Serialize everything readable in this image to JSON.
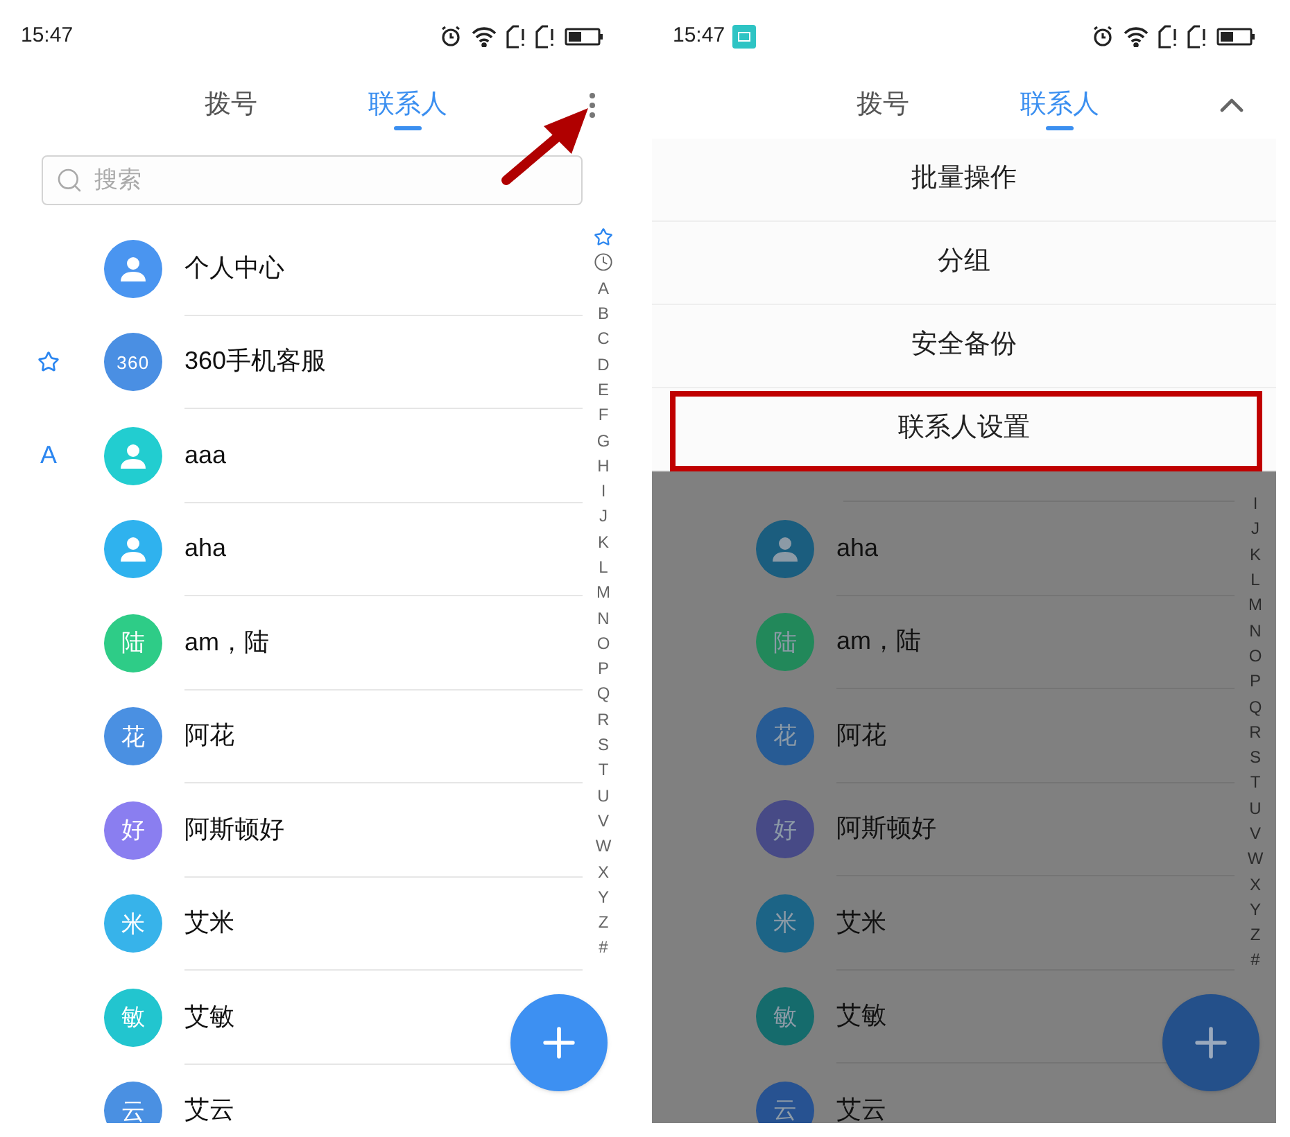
{
  "phones": [
    {
      "status_bar": {
        "time": "15:47",
        "screenshot_badge": false
      },
      "tabs": [
        {
          "label": "拨号",
          "selected": false
        },
        {
          "label": "联系人",
          "selected": true
        }
      ],
      "header_action": {
        "kind": "more"
      },
      "annotation": {
        "kind": "arrow"
      },
      "search": {
        "placeholder": "搜索"
      },
      "dimmed": false,
      "index_rail": [
        {
          "kind": "star"
        },
        {
          "kind": "clock"
        },
        {
          "kind": "letter",
          "label": "A"
        },
        {
          "kind": "letter",
          "label": "B"
        },
        {
          "kind": "letter",
          "label": "C"
        },
        {
          "kind": "letter",
          "label": "D"
        },
        {
          "kind": "letter",
          "label": "E"
        },
        {
          "kind": "letter",
          "label": "F"
        },
        {
          "kind": "letter",
          "label": "G"
        },
        {
          "kind": "letter",
          "label": "H"
        },
        {
          "kind": "letter",
          "label": "I"
        },
        {
          "kind": "letter",
          "label": "J"
        },
        {
          "kind": "letter",
          "label": "K"
        },
        {
          "kind": "letter",
          "label": "L"
        },
        {
          "kind": "letter",
          "label": "M"
        },
        {
          "kind": "letter",
          "label": "N"
        },
        {
          "kind": "letter",
          "label": "O"
        },
        {
          "kind": "letter",
          "label": "P"
        },
        {
          "kind": "letter",
          "label": "Q"
        },
        {
          "kind": "letter",
          "label": "R"
        },
        {
          "kind": "letter",
          "label": "S"
        },
        {
          "kind": "letter",
          "label": "T"
        },
        {
          "kind": "letter",
          "label": "U"
        },
        {
          "kind": "letter",
          "label": "V"
        },
        {
          "kind": "letter",
          "label": "W"
        },
        {
          "kind": "letter",
          "label": "X"
        },
        {
          "kind": "letter",
          "label": "Y"
        },
        {
          "kind": "letter",
          "label": "Z"
        },
        {
          "kind": "letter",
          "label": "#"
        }
      ],
      "contacts": [
        {
          "avatar": {
            "kind": "person",
            "color": "#4a95f0"
          },
          "name": "个人中心"
        },
        {
          "section": {
            "kind": "star"
          },
          "avatar": {
            "kind": "logo",
            "label": "360",
            "color": "#4a8fe3"
          },
          "name": "360手机客服"
        },
        {
          "section": {
            "kind": "letter",
            "label": "A"
          },
          "avatar": {
            "kind": "person",
            "color": "#22cdd0"
          },
          "name": "aaa"
        },
        {
          "avatar": {
            "kind": "person",
            "color": "#2fb2ee"
          },
          "name": "aha"
        },
        {
          "avatar": {
            "kind": "initial",
            "label": "陆",
            "color": "#2ecc87"
          },
          "name": "am，陆"
        },
        {
          "avatar": {
            "kind": "initial",
            "label": "花",
            "color": "#4a90e2"
          },
          "name": "阿花"
        },
        {
          "avatar": {
            "kind": "initial",
            "label": "好",
            "color": "#8a7ef0"
          },
          "name": "阿斯顿好"
        },
        {
          "avatar": {
            "kind": "initial",
            "label": "米",
            "color": "#37b3ea"
          },
          "name": "艾米"
        },
        {
          "avatar": {
            "kind": "initial",
            "label": "敏",
            "color": "#22c5cf"
          },
          "name": "艾敏"
        },
        {
          "avatar": {
            "kind": "initial",
            "label": "云",
            "color": "#4a90e2"
          },
          "name": "艾云"
        }
      ]
    },
    {
      "status_bar": {
        "time": "15:47",
        "screenshot_badge": true
      },
      "tabs": [
        {
          "label": "拨号",
          "selected": false
        },
        {
          "label": "联系人",
          "selected": true
        }
      ],
      "header_action": {
        "kind": "collapse"
      },
      "menu": [
        {
          "label": "批量操作",
          "highlighted": false
        },
        {
          "label": "分组",
          "highlighted": false
        },
        {
          "label": "安全备份",
          "highlighted": false
        },
        {
          "label": "联系人设置",
          "highlighted": true
        }
      ],
      "dimmed": true,
      "index_rail": [
        {
          "kind": "letter",
          "label": "I"
        },
        {
          "kind": "letter",
          "label": "J"
        },
        {
          "kind": "letter",
          "label": "K"
        },
        {
          "kind": "letter",
          "label": "L"
        },
        {
          "kind": "letter",
          "label": "M"
        },
        {
          "kind": "letter",
          "label": "N"
        },
        {
          "kind": "letter",
          "label": "O"
        },
        {
          "kind": "letter",
          "label": "P"
        },
        {
          "kind": "letter",
          "label": "Q"
        },
        {
          "kind": "letter",
          "label": "R"
        },
        {
          "kind": "letter",
          "label": "S"
        },
        {
          "kind": "letter",
          "label": "T"
        },
        {
          "kind": "letter",
          "label": "U"
        },
        {
          "kind": "letter",
          "label": "V"
        },
        {
          "kind": "letter",
          "label": "W"
        },
        {
          "kind": "letter",
          "label": "X"
        },
        {
          "kind": "letter",
          "label": "Y"
        },
        {
          "kind": "letter",
          "label": "Z"
        },
        {
          "kind": "letter",
          "label": "#"
        }
      ],
      "contacts": [
        {
          "avatar": {
            "kind": "person",
            "color": "#1b5d7e"
          },
          "name": "aha"
        },
        {
          "avatar": {
            "kind": "initial",
            "label": "陆",
            "color": "#22885a"
          },
          "name": "am，陆"
        },
        {
          "avatar": {
            "kind": "initial",
            "label": "花",
            "color": "#275b94"
          },
          "name": "阿花"
        },
        {
          "avatar": {
            "kind": "initial",
            "label": "好",
            "color": "#474a86"
          },
          "name": "阿斯顿好"
        },
        {
          "avatar": {
            "kind": "initial",
            "label": "米",
            "color": "#1c6486"
          },
          "name": "艾米"
        },
        {
          "avatar": {
            "kind": "initial",
            "label": "敏",
            "color": "#156b6c"
          },
          "name": "艾敏"
        },
        {
          "avatar": {
            "kind": "initial",
            "label": "云",
            "color": "#275291"
          },
          "name": "艾云"
        }
      ]
    }
  ]
}
